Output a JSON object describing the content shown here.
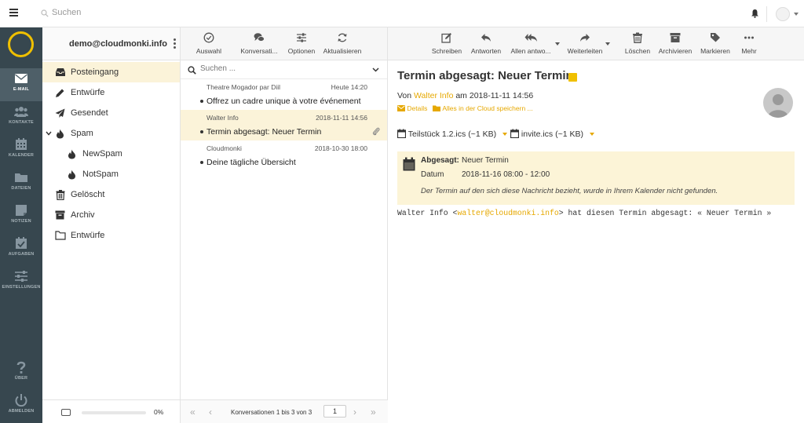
{
  "topbar": {
    "search_placeholder": "Suchen"
  },
  "nav": {
    "items": [
      {
        "label": "E-MAIL",
        "icon": "mail-icon"
      },
      {
        "label": "KONTAKTE",
        "icon": "contacts-icon"
      },
      {
        "label": "KALENDER",
        "icon": "calendar-icon"
      },
      {
        "label": "DATEIEN",
        "icon": "folder-icon"
      },
      {
        "label": "NOTIZEN",
        "icon": "notes-icon"
      },
      {
        "label": "AUFGABEN",
        "icon": "tasks-icon"
      },
      {
        "label": "EINSTELLUNGEN",
        "icon": "settings-icon"
      },
      {
        "label": "ÜBER",
        "icon": "question-icon"
      },
      {
        "label": "ABMELDEN",
        "icon": "power-icon"
      }
    ]
  },
  "account": {
    "name": "demo@cloudmonki.info"
  },
  "folders": [
    {
      "name": "Posteingang",
      "icon": "inbox-icon"
    },
    {
      "name": "Entwürfe",
      "icon": "pencil-icon"
    },
    {
      "name": "Gesendet",
      "icon": "paper-plane-icon"
    },
    {
      "name": "Spam",
      "icon": "fire-icon"
    },
    {
      "name": "NewSpam",
      "icon": "fire-icon"
    },
    {
      "name": "NotSpam",
      "icon": "fire-icon"
    },
    {
      "name": "Gelöscht",
      "icon": "trash-icon"
    },
    {
      "name": "Archiv",
      "icon": "archive-icon"
    },
    {
      "name": "Entwürfe",
      "icon": "folder-outline-icon"
    }
  ],
  "quota": {
    "percent_label": "0%",
    "fraction": 0
  },
  "list_toolbar": {
    "select": "Auswahl",
    "threads": "Konversati...",
    "options": "Optionen",
    "refresh": "Aktualisieren"
  },
  "list_search": {
    "placeholder": "Suchen ..."
  },
  "messages": [
    {
      "from": "Theatre Mogador par Diil",
      "date": "Heute 14:20",
      "subject": "Offrez un cadre unique à votre événement"
    },
    {
      "from": "Walter Info",
      "date": "2018-11-11 14:56",
      "subject": "Termin abgesagt: Neuer Termin"
    },
    {
      "from": "Cloudmonki",
      "date": "2018-10-30 18:00",
      "subject": "Deine tägliche Übersicht"
    }
  ],
  "pagination": {
    "info": "Konversationen 1 bis 3 von 3",
    "page": "1"
  },
  "read_toolbar": {
    "compose": "Schreiben",
    "reply": "Antworten",
    "reply_all": "Allen antwo...",
    "forward": "Weiterleiten",
    "delete": "Löschen",
    "archive": "Archivieren",
    "mark": "Markieren",
    "more": "Mehr"
  },
  "message": {
    "subject": "Termin abgesagt: Neuer Termin",
    "from_prefix": "Von",
    "from_name": "Walter Info",
    "date_prefix": "am",
    "date": "2018-11-11 14:56",
    "details": "Details",
    "save_cloud": "Alles in der Cloud speichern ...",
    "attachments": [
      {
        "name": "Teilstück 1.2.ics",
        "size": "(~1 KB)"
      },
      {
        "name": "invite.ics",
        "size": "(~1 KB)"
      }
    ],
    "invite": {
      "status_label": "Abgesagt:",
      "status_value": "Neuer Termin",
      "date_label": "Datum",
      "date_value": "2018-11-16 08:00 - 12:00",
      "note": "Der Termin auf den sich diese Nachricht bezieht, wurde in Ihrem Kalender nicht gefunden."
    },
    "body_prefix": "Walter Info <",
    "body_email": "walter@cloudmonki.info",
    "body_suffix": "> hat diesen Termin abgesagt: « Neuer Termin »"
  },
  "colors": {
    "accent": "#e6a800",
    "nav_bg": "#37474f",
    "highlight": "#fbf3d9"
  }
}
